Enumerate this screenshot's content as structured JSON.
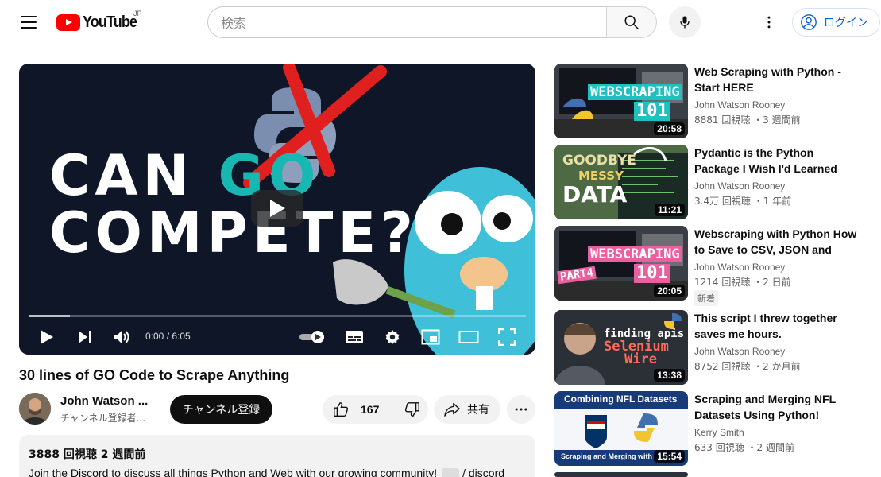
{
  "header": {
    "logo_text": "YouTube",
    "region": "JP",
    "search_placeholder": "検索",
    "login_label": "ログイン"
  },
  "player": {
    "thumb_line1_a": "CAN ",
    "thumb_line1_b": "GO",
    "thumb_line2": "COMPETE?",
    "time": "0:00 / 6:05",
    "progress_fraction": 0.0
  },
  "video": {
    "title": "30 lines of GO Code to Scrape Anything",
    "channel_name": "John Watson ...",
    "channel_subs": "チャンネル登録者...",
    "subscribe_label": "チャンネル登録",
    "likes": "167",
    "share_label": "共有",
    "desc_meta": "3888 回視聴  2 週間前",
    "desc_text": "Join the Discord to discuss all things Python and Web with our growing community!",
    "desc_link": "/ discord"
  },
  "recommendations": [
    {
      "title": "Web Scraping with Python - Start HERE",
      "channel": "John Watson Rooney",
      "meta": "8881 回視聴 ・3 週間前",
      "duration": "20:58",
      "thumb_text": "WEBSCRAPING\n101"
    },
    {
      "title": "Pydantic is the Python Package I Wish I'd Learned Earlier",
      "channel": "John Watson Rooney",
      "meta": "3.4万 回視聴 ・1 年前",
      "duration": "11:21",
      "thumb_text": "GOODBYE MESSY DATA"
    },
    {
      "title": "Webscraping with Python How to Save to CSV, JSON and Clea…",
      "channel": "John Watson Rooney",
      "meta": "1214 回視聴 ・2 日前",
      "duration": "20:05",
      "badge": "新着",
      "thumb_text": "WEBSCRAPING 101 PART4"
    },
    {
      "title": "This script I threw together saves me hours.",
      "channel": "John Watson Rooney",
      "meta": "8752 回視聴 ・2 か月前",
      "duration": "13:38",
      "thumb_text": "finding apis Selenium Wire"
    },
    {
      "title": "Scraping and Merging NFL Datasets Using Python!",
      "channel": "Kerry Smith",
      "meta": "633 回視聴 ・2 週間前",
      "duration": "15:54",
      "thumb_text": "Combining NFL Datasets"
    }
  ]
}
